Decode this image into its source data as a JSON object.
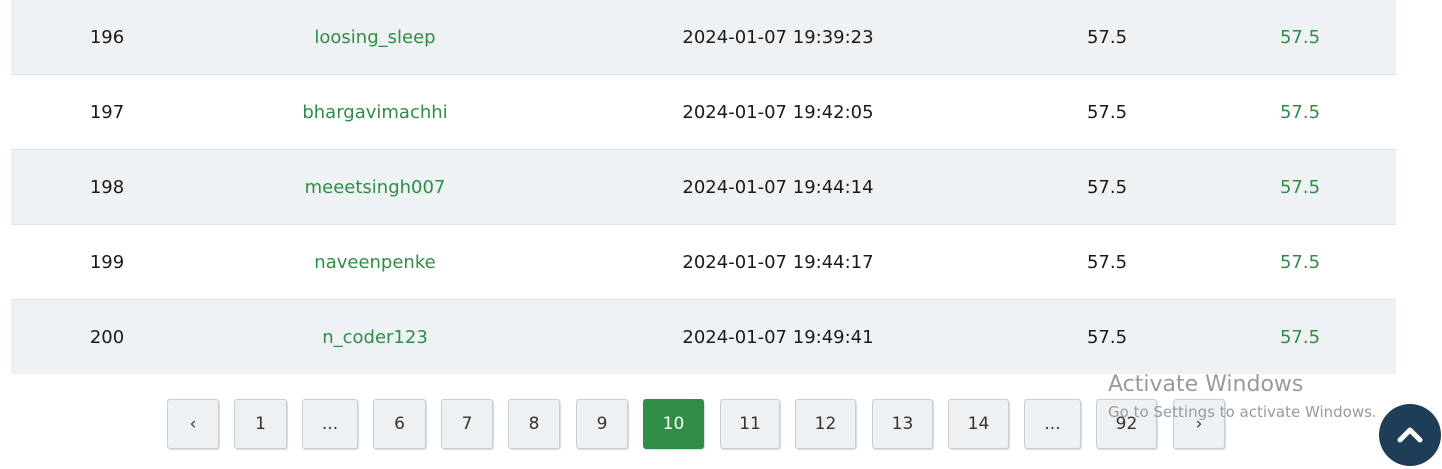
{
  "table": {
    "rows": [
      {
        "rank": "196",
        "user": "loosing_sleep",
        "time": "2024-01-07 19:39:23",
        "score": "57.5",
        "total": "57.5"
      },
      {
        "rank": "197",
        "user": "bhargavimachhi",
        "time": "2024-01-07 19:42:05",
        "score": "57.5",
        "total": "57.5"
      },
      {
        "rank": "198",
        "user": "meeetsingh007",
        "time": "2024-01-07 19:44:14",
        "score": "57.5",
        "total": "57.5"
      },
      {
        "rank": "199",
        "user": "naveenpenke",
        "time": "2024-01-07 19:44:17",
        "score": "57.5",
        "total": "57.5"
      },
      {
        "rank": "200",
        "user": "n_coder123",
        "time": "2024-01-07 19:49:41",
        "score": "57.5",
        "total": "57.5"
      }
    ]
  },
  "pagination": {
    "prev": "‹",
    "next": "›",
    "pages": [
      "1",
      "...",
      "6",
      "7",
      "8",
      "9",
      "10",
      "11",
      "12",
      "13",
      "14",
      "...",
      "92"
    ],
    "active": "10"
  },
  "watermark": {
    "title": "Activate Windows",
    "subtitle": "Go to Settings to activate Windows."
  },
  "colors": {
    "accent": "#2f8d46",
    "row_alt": "#eff2f5",
    "scroll_button": "#1f3d56"
  },
  "icons": {
    "scroll_top": "chevron-up-icon"
  }
}
